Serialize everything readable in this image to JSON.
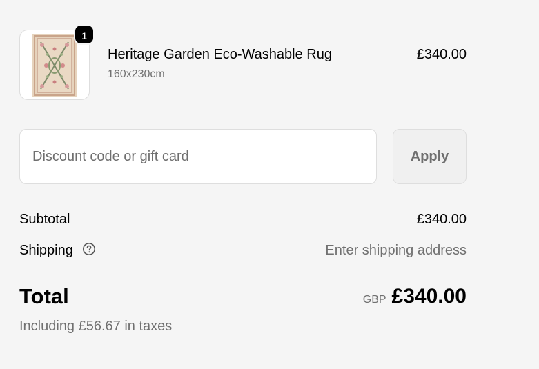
{
  "product": {
    "quantity": "1",
    "name": "Heritage Garden Eco-Washable Rug",
    "variant": "160x230cm",
    "price": "£340.00",
    "image_icon": "rug-thumbnail"
  },
  "discount": {
    "placeholder": "Discount code or gift card",
    "value": "",
    "apply_label": "Apply"
  },
  "totals": {
    "subtotal_label": "Subtotal",
    "subtotal_value": "£340.00",
    "shipping_label": "Shipping",
    "shipping_help_icon": "question-circle",
    "shipping_value": "Enter shipping address",
    "total_label": "Total",
    "currency_code": "GBP",
    "total_value": "£340.00",
    "tax_note": "Including £56.67 in taxes"
  },
  "colors": {
    "background": "#f5f5f5",
    "muted_text": "#707070",
    "badge": "#000000"
  }
}
